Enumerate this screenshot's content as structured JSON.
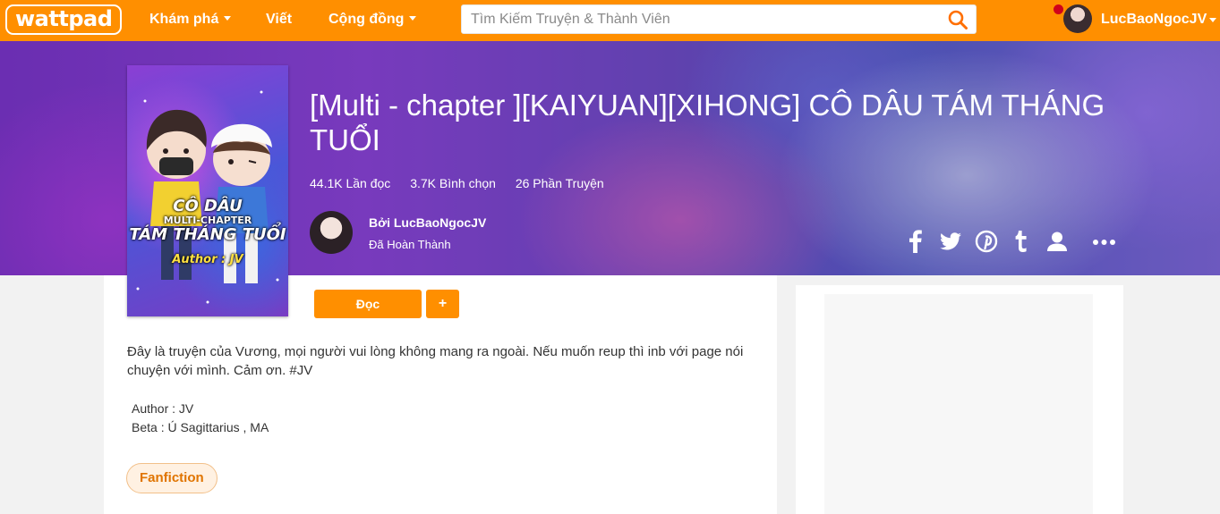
{
  "nav": {
    "logo": "wattpad",
    "explore": "Khám phá",
    "write": "Viết",
    "community": "Cộng đồng",
    "search_placeholder": "Tìm Kiếm Truyện & Thành Viên",
    "username": "LucBaoNgocJV"
  },
  "story": {
    "title": "[Multi - chapter ][KAIYUAN][XIHONG] CÔ DÂU TÁM THÁNG TUỔI",
    "reads": "44.1K Lần đọc",
    "votes": "3.7K Bình chọn",
    "parts": "26 Phần Truyện",
    "author_line": "Bởi LucBaoNgocJV",
    "status": "Đã Hoàn Thành",
    "cover_text": {
      "line1": "CÔ DÂU",
      "line2": "MULTI-CHAPTER",
      "line3": "TÁM THÁNG TUỔI",
      "line4": "Author : JV"
    },
    "read_button": "Đọc",
    "add_button": "+",
    "description": "Đây là truyện của Vương, mọi người vui lòng không mang ra ngoài. Nếu muốn reup thì inb với page nói chuyện với mình. Cảm ơn. #JV",
    "author_meta": "Author : JV",
    "beta_meta": "Beta : Ú Sagittarius , MA",
    "tag": "Fanfiction"
  },
  "colors": {
    "brand": "#ff8f00",
    "tag_text": "#e07400"
  },
  "share_icons": [
    "facebook-icon",
    "twitter-icon",
    "pinterest-icon",
    "tumblr-icon",
    "user-icon",
    "more-icon"
  ]
}
